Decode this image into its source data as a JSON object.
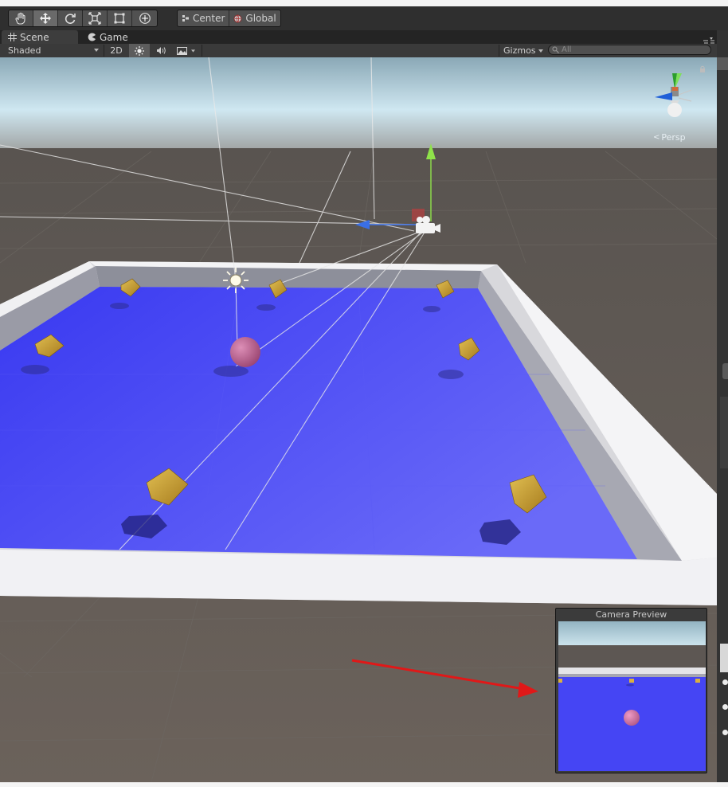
{
  "toolbar": {
    "transform_tools": [
      {
        "name": "hand-tool-button",
        "icon": "hand-icon"
      },
      {
        "name": "move-tool-button",
        "icon": "move-arrows-icon"
      },
      {
        "name": "rotate-tool-button",
        "icon": "rotate-icon"
      },
      {
        "name": "scale-tool-button",
        "icon": "scale-icon"
      },
      {
        "name": "rect-tool-button",
        "icon": "rect-transform-icon"
      },
      {
        "name": "transform-tool-button",
        "icon": "transform-icon"
      }
    ],
    "pivot_mode": "Center",
    "pivot_rotation": "Global"
  },
  "tabs": {
    "scene": "Scene",
    "game": "Game"
  },
  "scene_bar": {
    "shading_mode": "Shaded",
    "mode_2d": "2D",
    "gizmos": "Gizmos",
    "search_placeholder": "All"
  },
  "orientation_gizmo": {
    "projection_label": "Persp"
  },
  "camera_preview": {
    "title": "Camera Preview"
  },
  "colors": {
    "floor": "#4a4af5",
    "walls": "#efeff2",
    "sky": "#c9e4ef",
    "ground": "#625a54",
    "pickup": "#c9a032",
    "player_sphere": "#c46b97",
    "annotation_arrow": "#e01818"
  }
}
